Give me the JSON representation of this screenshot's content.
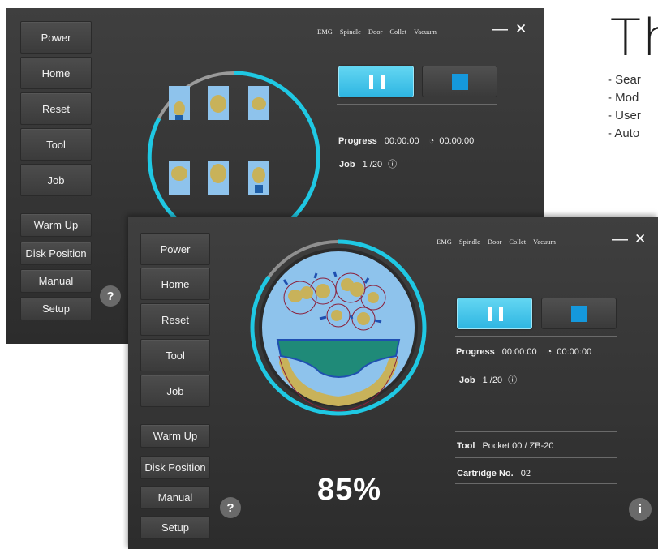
{
  "document": {
    "title": "Th",
    "bullets": [
      "- Sear",
      "- Mod",
      "- User",
      "- Auto"
    ]
  },
  "back_window": {
    "menu": [
      "Power",
      "Home",
      "Reset",
      "Tool",
      "Job",
      "Warm Up",
      "Disk Position",
      "Manual",
      "Setup"
    ],
    "status": [
      "EMG",
      "Spindle",
      "Door",
      "Collet",
      "Vacuum"
    ],
    "minimize": "—",
    "close": "✕",
    "progress_label": "Progress",
    "progress_time": "00:00:00",
    "remaining_time": "00:00:00",
    "job_label": "Job",
    "job_value": "1 /20",
    "help": "?"
  },
  "front_window": {
    "menu": [
      "Power",
      "Home",
      "Reset",
      "Tool",
      "Job",
      "Warm Up",
      "Disk Position",
      "Manual",
      "Setup"
    ],
    "status": [
      "EMG",
      "Spindle",
      "Door",
      "Collet",
      "Vacuum"
    ],
    "minimize": "—",
    "close": "✕",
    "progress_label": "Progress",
    "progress_time": "00:00:00",
    "remaining_time": "00:00:00",
    "job_label": "Job",
    "job_value": "1 /20",
    "tool_label": "Tool",
    "tool_value": "Pocket 00 / ZB-20",
    "cartridge_label": "Cartridge No.",
    "cartridge_value": "02",
    "percent": "85%",
    "progress_fraction": 0.85,
    "help": "?",
    "info": "i"
  },
  "colors": {
    "accent": "#1fc8e3",
    "stop_square": "#1598dc",
    "disk_blue": "#8ec3ec",
    "part_gold": "#c8b25a",
    "support_green": "#1f8a78"
  }
}
